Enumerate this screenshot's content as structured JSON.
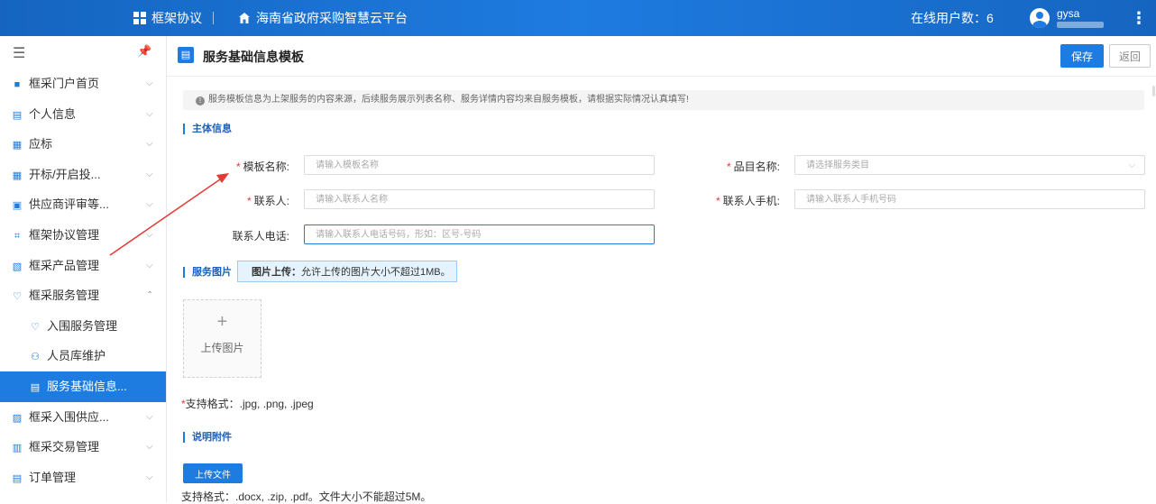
{
  "topbar": {
    "app_label": "框架协议",
    "platform_title": "海南省政府采购智慧云平台",
    "online_users": "在线用户数：6",
    "username": "gysa"
  },
  "sidebar": {
    "items": [
      {
        "label": "框采门户首页",
        "icon": "grid-icon",
        "chevron": "⌵"
      },
      {
        "label": "个人信息",
        "icon": "person-card-icon",
        "chevron": "⌵"
      },
      {
        "label": "应标",
        "icon": "document-icon",
        "chevron": "⌵"
      },
      {
        "label": "开标/开启投...",
        "icon": "document-icon",
        "chevron": "⌵"
      },
      {
        "label": "供应商评审等...",
        "icon": "review-icon",
        "chevron": "⌵"
      },
      {
        "label": "框架协议管理",
        "icon": "agreement-icon",
        "chevron": "⌵"
      },
      {
        "label": "框采产品管理",
        "icon": "product-icon",
        "chevron": "⌵"
      },
      {
        "label": "框采服务管理",
        "icon": "service-icon",
        "chevron": "⌃"
      },
      {
        "label": "入围服务管理",
        "icon": "heart-hand-icon",
        "chevron": ""
      },
      {
        "label": "人员库维护",
        "icon": "person-icon",
        "chevron": ""
      },
      {
        "label": "服务基础信息...",
        "icon": "info-card-icon",
        "chevron": ""
      },
      {
        "label": "框采入围供应...",
        "icon": "supplier-icon",
        "chevron": "⌵"
      },
      {
        "label": "框采交易管理",
        "icon": "trade-icon",
        "chevron": "⌵"
      },
      {
        "label": "订单管理",
        "icon": "order-icon",
        "chevron": "⌵"
      }
    ]
  },
  "page": {
    "title": "服务基础信息模板",
    "save_label": "保存",
    "back_label": "返回",
    "notice": "服务模板信息为上架服务的内容来源，后续服务展示列表名称、服务详情内容均来自服务模板，请根据实际情况认真填写!"
  },
  "sections": {
    "main_info": "主体信息",
    "service_image": "服务图片",
    "attachment": "说明附件"
  },
  "form": {
    "template_name_label": "模板名称:",
    "template_name_placeholder": "请输入模板名称",
    "category_label": "品目名称:",
    "category_placeholder": "请选择服务类目",
    "contact_label": "联系人:",
    "contact_placeholder": "请输入联系人名称",
    "contact_mobile_label": "联系人手机:",
    "contact_mobile_placeholder": "请输入联系人手机号码",
    "contact_phone_label": "联系人电话:",
    "contact_phone_placeholder": "请输入联系人电话号码，形如：区号-号码"
  },
  "image_upload": {
    "note_bold": "图片上传：",
    "note_text": "允许上传的图片大小不超过1MB。",
    "plus": "+",
    "upload_label": "上传图片",
    "formats": "支持格式：.jpg, .png, .jpeg"
  },
  "attachment": {
    "upload_button": "上传文件",
    "formats": "支持格式：.docx, .zip, .pdf。文件大小不能超过5M。"
  },
  "colors": {
    "primary": "#1e7be0",
    "required": "#e53935",
    "annotation": "#e53935"
  }
}
